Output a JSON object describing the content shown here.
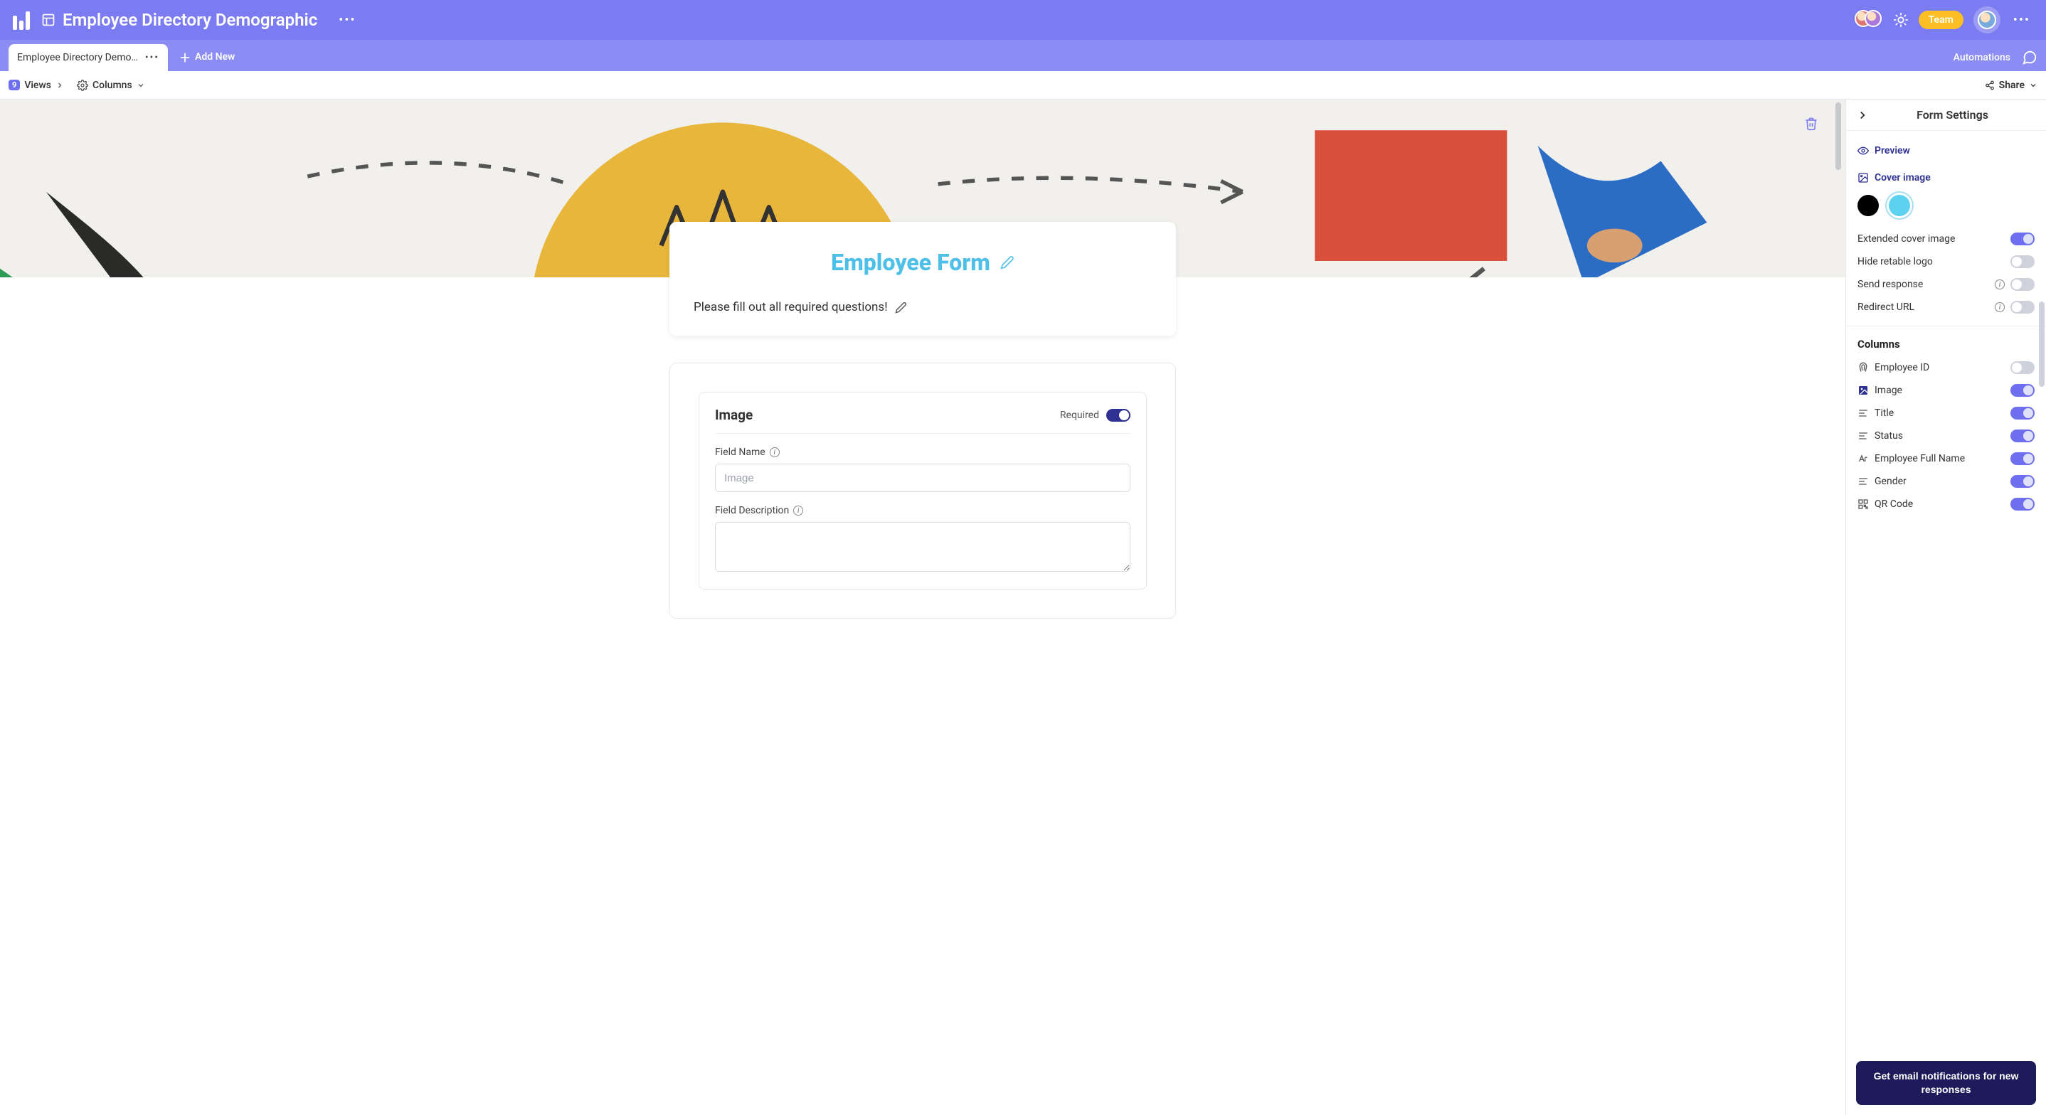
{
  "header": {
    "page_title": "Employee Directory Demographic",
    "team_label": "Team"
  },
  "tabs": {
    "active_tab": "Employee Directory Demo…",
    "add_new": "Add New",
    "automations": "Automations"
  },
  "toolbar": {
    "views_count": "9",
    "views_label": "Views",
    "columns_label": "Columns",
    "share_label": "Share"
  },
  "form": {
    "title": "Employee Form",
    "description": "Please fill out all required questions!"
  },
  "field_card": {
    "title": "Image",
    "required_label": "Required",
    "required_on": true,
    "field_name_label": "Field Name",
    "field_name_placeholder": "Image",
    "field_desc_label": "Field Description"
  },
  "settings": {
    "panel_title": "Form Settings",
    "preview": "Preview",
    "cover_image": "Cover image",
    "selected_color": "blue",
    "toggles": [
      {
        "label": "Extended cover image",
        "on": true,
        "info": false
      },
      {
        "label": "Hide retable logo",
        "on": false,
        "info": false
      },
      {
        "label": "Send response",
        "on": false,
        "info": true
      },
      {
        "label": "Redirect URL",
        "on": false,
        "info": true
      }
    ],
    "columns_title": "Columns",
    "columns": [
      {
        "icon": "fingerprint",
        "label": "Employee ID",
        "on": false
      },
      {
        "icon": "image",
        "label": "Image",
        "on": true
      },
      {
        "icon": "text-left",
        "label": "Title",
        "on": true
      },
      {
        "icon": "text-left",
        "label": "Status",
        "on": true
      },
      {
        "icon": "typography",
        "label": "Employee Full Name",
        "on": true
      },
      {
        "icon": "text-left",
        "label": "Gender",
        "on": true
      },
      {
        "icon": "qr",
        "label": "QR Code",
        "on": true
      }
    ],
    "notify_button": "Get email notifications for new responses"
  }
}
